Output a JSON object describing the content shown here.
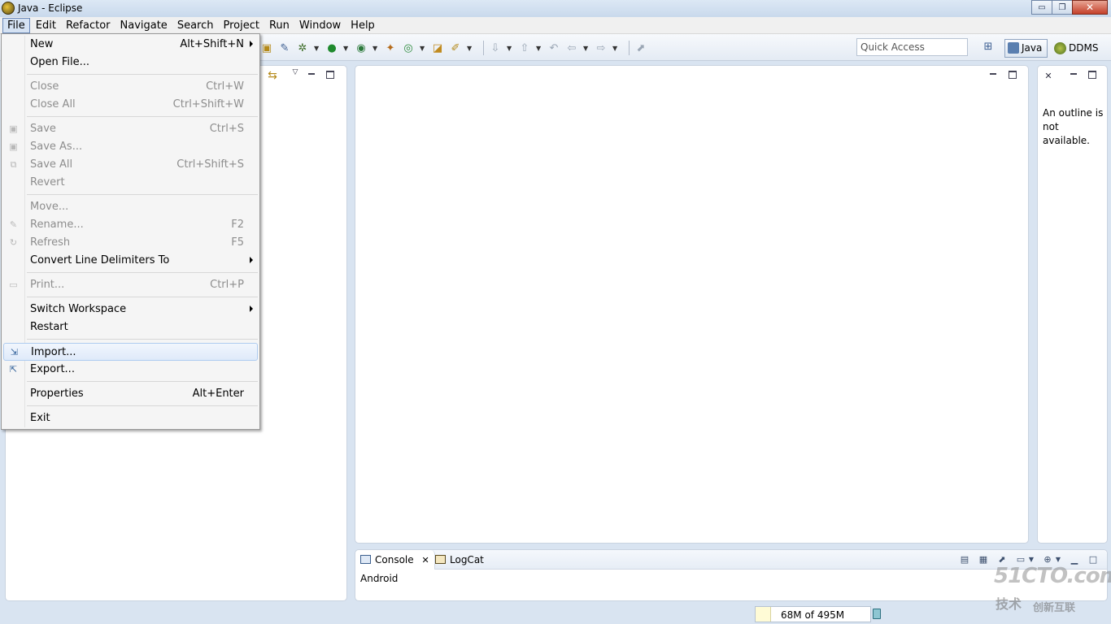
{
  "window": {
    "title": "Java - Eclipse",
    "min_label": "▭",
    "max_label": "❐",
    "close_label": "✕"
  },
  "menubar": [
    "File",
    "Edit",
    "Refactor",
    "Navigate",
    "Search",
    "Project",
    "Run",
    "Window",
    "Help"
  ],
  "toolbar": {
    "quick_access_placeholder": "Quick Access",
    "perspectives": {
      "java": "Java",
      "ddms": "DDMS"
    }
  },
  "file_menu": {
    "items": [
      {
        "label": "New",
        "shortcut": "Alt+Shift+N",
        "submenu": true
      },
      {
        "label": "Open File...",
        "shortcut": ""
      },
      {
        "label": "Close",
        "shortcut": "Ctrl+W"
      },
      {
        "label": "Close All",
        "shortcut": "Ctrl+Shift+W"
      },
      {
        "label": "Save",
        "shortcut": "Ctrl+S"
      },
      {
        "label": "Save As...",
        "shortcut": ""
      },
      {
        "label": "Save All",
        "shortcut": "Ctrl+Shift+S"
      },
      {
        "label": "Revert",
        "shortcut": ""
      },
      {
        "label": "Move...",
        "shortcut": ""
      },
      {
        "label": "Rename...",
        "shortcut": "F2"
      },
      {
        "label": "Refresh",
        "shortcut": "F5"
      },
      {
        "label": "Convert Line Delimiters To",
        "shortcut": "",
        "submenu": true
      },
      {
        "label": "Print...",
        "shortcut": "Ctrl+P"
      },
      {
        "label": "Switch Workspace",
        "shortcut": "",
        "submenu": true
      },
      {
        "label": "Restart",
        "shortcut": ""
      },
      {
        "label": "Import...",
        "shortcut": ""
      },
      {
        "label": "Export...",
        "shortcut": ""
      },
      {
        "label": "Properties",
        "shortcut": "Alt+Enter"
      },
      {
        "label": "Exit",
        "shortcut": ""
      }
    ]
  },
  "outline": {
    "message": "An outline is not available."
  },
  "console": {
    "tabs": [
      {
        "label": "Console"
      },
      {
        "label": "LogCat"
      }
    ],
    "content": "Android"
  },
  "status": {
    "heap": "68M of 495M"
  },
  "watermark": {
    "line1": "51CTO.com",
    "line2": "技术",
    "line3": "创新互联"
  },
  "colors": {
    "accent": "#d5e2f3",
    "chrome": "#d9e4f1",
    "menu_bg": "#f5f5f5"
  }
}
